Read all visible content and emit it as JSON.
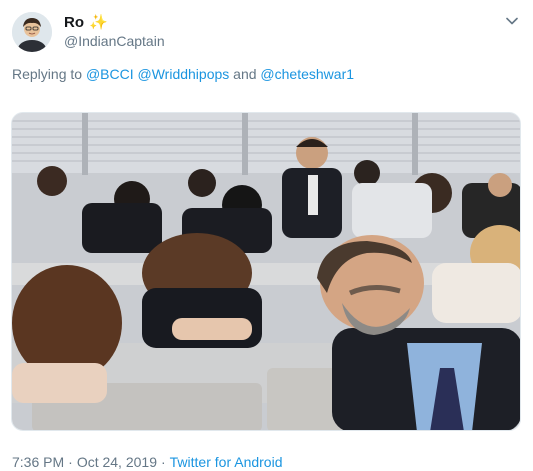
{
  "tweet": {
    "display_name": "Ro",
    "handle": "@IndianCaptain",
    "replying_prefix": "Replying to",
    "mentions": [
      "@BCCI",
      "@Wriddhipops"
    ],
    "and_word": "and",
    "last_mention": "@cheteshwar1",
    "time": "7:36 PM",
    "separator": "·",
    "date": "Oct 24, 2019",
    "source": "Twitter for Android"
  },
  "icons": {
    "sparkle": "✨",
    "caret": "chevron-down-icon"
  },
  "colors": {
    "link": "#1b95e0",
    "secondary_text": "#657786",
    "primary_text": "#14171a"
  }
}
